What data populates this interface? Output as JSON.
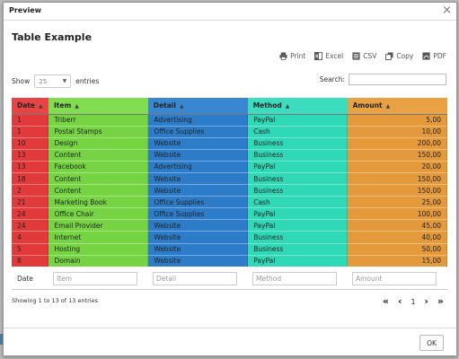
{
  "modal": {
    "title": "Preview",
    "close_glyph": "×"
  },
  "page_title": "Table Example",
  "export_buttons": [
    {
      "label": "Print",
      "icon": "print-icon"
    },
    {
      "label": "Excel",
      "icon": "excel-icon"
    },
    {
      "label": "CSV",
      "icon": "csv-icon"
    },
    {
      "label": "Copy",
      "icon": "copy-icon"
    },
    {
      "label": "PDF",
      "icon": "pdf-icon"
    }
  ],
  "length": {
    "show_label": "Show",
    "value": "25",
    "entries_label": "entries"
  },
  "search": {
    "label": "Search:",
    "value": ""
  },
  "table": {
    "headers": [
      "Date",
      "Item",
      "Detail",
      "Method",
      "Amount"
    ],
    "rows": [
      [
        "1",
        "Triberr",
        "Advertising",
        "PayPal",
        "5,00"
      ],
      [
        "1",
        "Postal Stamps",
        "Office Supplies",
        "Cash",
        "10,00"
      ],
      [
        "10",
        "Design",
        "Website",
        "Business",
        "200,00"
      ],
      [
        "13",
        "Content",
        "Website",
        "Business",
        "150,00"
      ],
      [
        "13",
        "Facebook",
        "Advertising",
        "PayPal",
        "20,00"
      ],
      [
        "18",
        "Content",
        "Website",
        "Business",
        "150,00"
      ],
      [
        "2",
        "Content",
        "Website",
        "Business",
        "150,00"
      ],
      [
        "21",
        "Marketing Book",
        "Office Supplies",
        "Cash",
        "25,00"
      ],
      [
        "24",
        "Office Chair",
        "Office Supplies",
        "PayPal",
        "100,00"
      ],
      [
        "24",
        "Email Provider",
        "Website",
        "PayPal",
        "45,00"
      ],
      [
        "4",
        "Internet",
        "Website",
        "Business",
        "40,00"
      ],
      [
        "5",
        "Hosting",
        "Website",
        "Business",
        "50,00"
      ],
      [
        "8",
        "Domain",
        "Website",
        "PayPal",
        "15,00"
      ]
    ],
    "colors": {
      "date": "#e23a3a",
      "item": "#76d443",
      "detail": "#2d7cc9",
      "method": "#2fd8b7",
      "amount": "#e49a3a"
    }
  },
  "filters": {
    "date_label": "Date",
    "item_placeholder": "Item",
    "detail_placeholder": "Detail",
    "method_placeholder": "Method",
    "amount_placeholder": "Amount"
  },
  "info": "Showing 1 to 13 of 13 entries",
  "pager": {
    "first": "«",
    "prev": "‹",
    "page": "1",
    "next": "›",
    "last": "»"
  },
  "footer": {
    "ok_label": "OK"
  }
}
